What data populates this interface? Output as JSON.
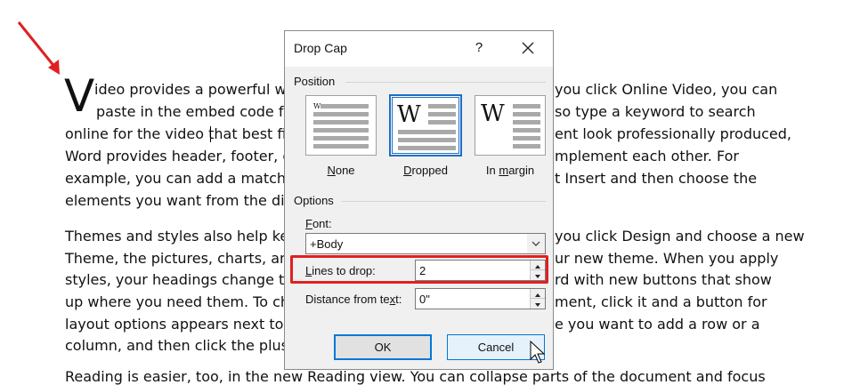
{
  "document": {
    "drop_cap_letter": "V",
    "paragraph1": [
      "ideo provides a powerful wa",
      "paste in the embed code fo",
      "online for the video that best fit",
      "Word provides header, footer, c",
      "example, you can add a matchin",
      "elements you want from the diff"
    ],
    "paragraph1_right": [
      "you click Online Video, you can",
      "so type a keyword to search",
      "ent look professionally produced,",
      "mplement each other. For",
      "t Insert and then choose the",
      ""
    ],
    "paragraph2": [
      "Themes and styles also help kee",
      "Theme, the pictures, charts, and",
      "styles, your headings change to",
      "up where you need them. To cha",
      "layout options appears next to it",
      "column, and then click the plus s"
    ],
    "paragraph2_right": [
      "you click Design and choose a new",
      "ur new theme. When you apply",
      "rd with new buttons that show",
      "ment, click it and a button for",
      "e you want to add a row or a",
      ""
    ],
    "paragraph3_partial": "Reading is easier, too, in the new Reading view. You can collapse parts of the document and focus"
  },
  "dialog": {
    "title": "Drop Cap",
    "help": "?",
    "position_label": "Position",
    "positions": [
      {
        "label_u": "N",
        "label_rest": "one",
        "selected": false
      },
      {
        "label_u": "D",
        "label_rest": "ropped",
        "selected": true
      },
      {
        "label_pre": "In ",
        "label_u": "m",
        "label_rest": "argin",
        "selected": false
      }
    ],
    "preview_letter": "W",
    "options_label": "Options",
    "font_label_u": "F",
    "font_label_rest": "ont:",
    "font_value": "+Body",
    "lines_label_u": "L",
    "lines_label_rest": "ines to drop:",
    "lines_value": "2",
    "distance_label_pre": "Distance from te",
    "distance_label_u": "x",
    "distance_label_rest": "t:",
    "distance_value": "0\"",
    "ok_label": "OK",
    "cancel_label": "Cancel"
  },
  "colors": {
    "highlight": "#e02020",
    "arrow": "#e02020",
    "accent": "#0078d7"
  }
}
